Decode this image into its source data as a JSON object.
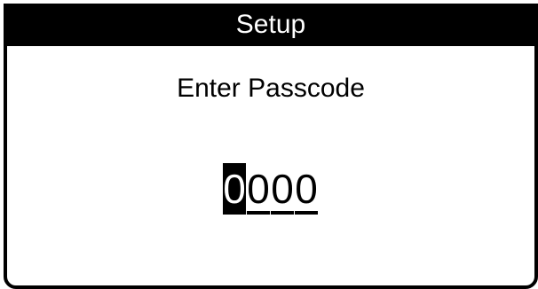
{
  "title": "Setup",
  "prompt": "Enter Passcode",
  "passcode": {
    "digits": [
      "0",
      "0",
      "0",
      "0"
    ],
    "active_index": 0
  }
}
